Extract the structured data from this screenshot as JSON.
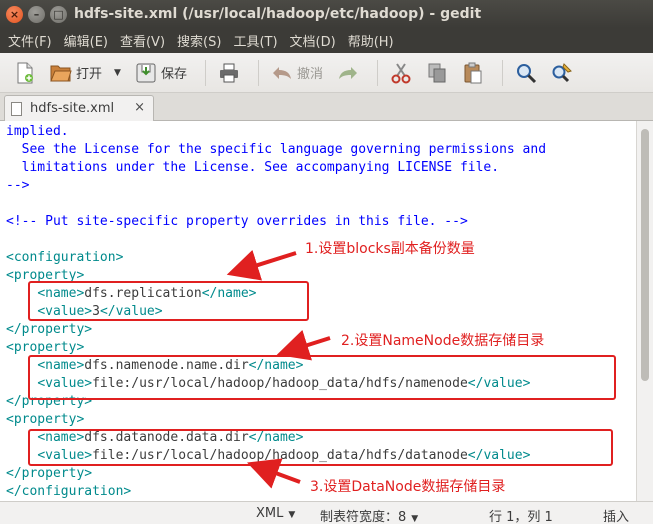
{
  "window": {
    "title": "hdfs-site.xml (/usr/local/hadoop/etc/hadoop) - gedit",
    "close_glyph": "×",
    "minimize_glyph": "–",
    "maximize_glyph": "□"
  },
  "menu": [
    "文件(F)",
    "编辑(E)",
    "查看(V)",
    "搜索(S)",
    "工具(T)",
    "文档(D)",
    "帮助(H)"
  ],
  "toolbar": {
    "open_label": "打开",
    "save_label": "保存",
    "undo_label": "撤消",
    "dropdown_glyph": "▼"
  },
  "tab": {
    "label": "hdfs-site.xml",
    "close_glyph": "×"
  },
  "editor": {
    "lines": [
      {
        "segments": [
          {
            "t": "implied.",
            "c": "comment"
          }
        ]
      },
      {
        "segments": [
          {
            "t": "  See the License for the specific language governing permissions and",
            "c": "comment"
          }
        ]
      },
      {
        "segments": [
          {
            "t": "  limitations under the License. See accompanying LICENSE file.",
            "c": "comment"
          }
        ]
      },
      {
        "segments": [
          {
            "t": "-->",
            "c": "comment"
          }
        ]
      },
      {
        "segments": []
      },
      {
        "segments": [
          {
            "t": "<!-- Put site-specific property overrides in this file. -->",
            "c": "comment"
          }
        ]
      },
      {
        "segments": []
      },
      {
        "segments": [
          {
            "t": "<configuration>",
            "c": "tag"
          }
        ]
      },
      {
        "segments": [
          {
            "t": "<property>",
            "c": "tag"
          }
        ]
      },
      {
        "segments": [
          {
            "t": "    ",
            "c": "text"
          },
          {
            "t": "<name>",
            "c": "tag"
          },
          {
            "t": "dfs.replication",
            "c": "text"
          },
          {
            "t": "</name>",
            "c": "tag"
          }
        ]
      },
      {
        "segments": [
          {
            "t": "    ",
            "c": "text"
          },
          {
            "t": "<value>",
            "c": "tag"
          },
          {
            "t": "3",
            "c": "text"
          },
          {
            "t": "</value>",
            "c": "tag"
          }
        ]
      },
      {
        "segments": [
          {
            "t": "</property>",
            "c": "tag"
          }
        ]
      },
      {
        "segments": [
          {
            "t": "<property>",
            "c": "tag"
          }
        ]
      },
      {
        "segments": [
          {
            "t": "    ",
            "c": "text"
          },
          {
            "t": "<name>",
            "c": "tag"
          },
          {
            "t": "dfs.namenode.name.dir",
            "c": "text"
          },
          {
            "t": "</name>",
            "c": "tag"
          }
        ]
      },
      {
        "segments": [
          {
            "t": "    ",
            "c": "text"
          },
          {
            "t": "<value>",
            "c": "tag"
          },
          {
            "t": "file:/usr/local/hadoop/hadoop_data/hdfs/namenode",
            "c": "text"
          },
          {
            "t": "</value>",
            "c": "tag"
          }
        ]
      },
      {
        "segments": [
          {
            "t": "</property>",
            "c": "tag"
          }
        ]
      },
      {
        "segments": [
          {
            "t": "<property>",
            "c": "tag"
          }
        ]
      },
      {
        "segments": [
          {
            "t": "    ",
            "c": "text"
          },
          {
            "t": "<name>",
            "c": "tag"
          },
          {
            "t": "dfs.datanode.data.dir",
            "c": "text"
          },
          {
            "t": "</name>",
            "c": "tag"
          }
        ]
      },
      {
        "segments": [
          {
            "t": "    ",
            "c": "text"
          },
          {
            "t": "<value>",
            "c": "tag"
          },
          {
            "t": "file:/usr/local/hadoop/hadoop_data/hdfs/datanode",
            "c": "text"
          },
          {
            "t": "</value>",
            "c": "tag"
          }
        ]
      },
      {
        "segments": [
          {
            "t": "</property>",
            "c": "tag"
          }
        ]
      },
      {
        "segments": [
          {
            "t": "</configuration>",
            "c": "tag"
          }
        ]
      }
    ]
  },
  "annotations": {
    "a1": "1.设置blocks副本备份数量",
    "a2": "2.设置NameNode数据存储目录",
    "a3": "3.设置DataNode数据存储目录"
  },
  "statusbar": {
    "language": "XML",
    "tab_width": "制表符宽度：8",
    "position": "行 1，列 1",
    "mode": "插入",
    "caret_glyph": "▼"
  },
  "colors": {
    "comment": "#0000ff",
    "tag": "#008a8c",
    "text": "#3c3c3c",
    "annotation": "#e02020"
  }
}
